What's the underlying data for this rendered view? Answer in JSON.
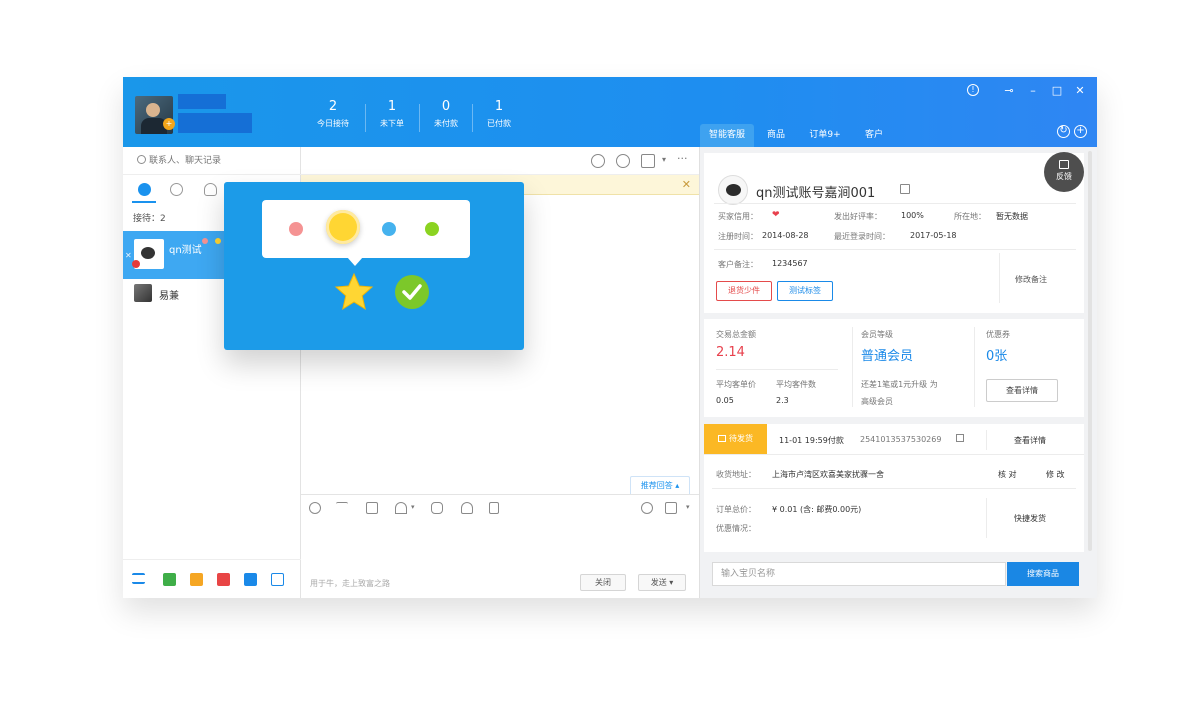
{
  "header": {
    "stats": [
      {
        "num": "2",
        "label": "今日接待"
      },
      {
        "num": "1",
        "label": "未下单"
      },
      {
        "num": "0",
        "label": "未付款"
      },
      {
        "num": "1",
        "label": "已付款"
      }
    ],
    "tabs": [
      "智能客服",
      "商品",
      "订单9+",
      "客户"
    ]
  },
  "left": {
    "search_placeholder": "联系人、聊天记录",
    "reception_label": "接待：2",
    "contacts": [
      {
        "name": "qn测试"
      },
      {
        "name": "易兼"
      }
    ]
  },
  "middle": {
    "suggest_label": "推荐回答 ▴",
    "input_placeholder": "用于牛，走上致富之路",
    "close_label": "关闭",
    "send_label": "发送 ▾"
  },
  "customer": {
    "name": "qn测试账号嘉涧001",
    "credit_label": "买家信用：",
    "credit_value": "❤",
    "good_rate_label": "发出好评率：",
    "good_rate_value": "100%",
    "location_label": "所在地：",
    "location_value": "暂无数据",
    "reg_label": "注册时间：",
    "reg_value": "2014-08-28",
    "last_login_label": "最近登录时间：",
    "last_login_value": "2017-05-18",
    "remark_label": "客户备注：",
    "remark_value": "1234567",
    "tags": [
      "退货少件",
      "测试标签"
    ],
    "edit_remark": "修改备注",
    "feedback": "反馈"
  },
  "stats": {
    "total_label": "交易总金额",
    "total_value": "2.14",
    "level_label": "会员等级",
    "level_value": "普通会员",
    "coupon_label": "优惠券",
    "coupon_value": "0张",
    "avg_price_label": "平均客单价",
    "avg_price_value": "0.05",
    "avg_count_label": "平均客件数",
    "avg_count_value": "2.3",
    "upgrade_text_1": "还差1笔或1元升级 为",
    "upgrade_text_2": "高级会员",
    "detail_button": "查看详情"
  },
  "order": {
    "status": "待发货",
    "time": "11-01 19:59付款",
    "order_no": "2541013537530269",
    "view_detail": "查看详情",
    "address_label": "收货地址：",
    "address_value": "上海市卢湾区欢喜美家扰骤一舍",
    "verify": "核 对",
    "modify": "修 改",
    "total_label": "订单总价：",
    "total_value": "¥ 0.01 (含: 邮费0.00元)",
    "discount_label": "优惠情况：",
    "quick_ship": "快捷发货"
  },
  "product_search": {
    "placeholder": "输入宝贝名称",
    "button": "搜索商品"
  },
  "colors": {
    "header_blue": "#1a97ea",
    "accent_blue": "#1a89e8",
    "price_red": "#e8414d",
    "status_yellow": "#fbb824",
    "popup_blue": "#1c9be8"
  }
}
